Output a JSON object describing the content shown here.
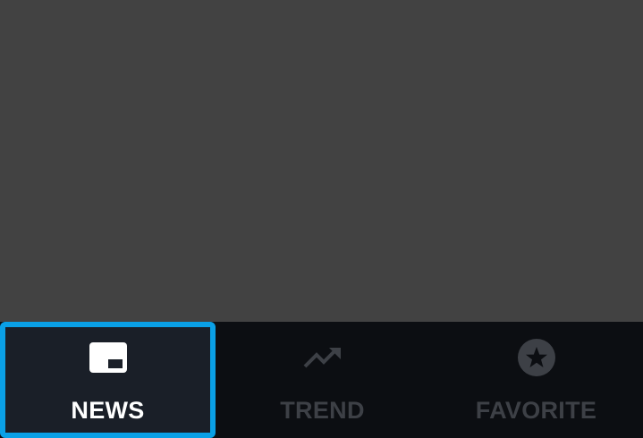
{
  "bottom_nav": {
    "tabs": [
      {
        "label": "NEWS",
        "icon": "news-icon",
        "selected": true
      },
      {
        "label": "TREND",
        "icon": "trending-up-icon",
        "selected": false
      },
      {
        "label": "FAVORITE",
        "icon": "star-circle-icon",
        "selected": false
      }
    ]
  },
  "colors": {
    "content_bg": "#424242",
    "nav_bg": "#0c0e12",
    "selected_bg": "#1a1f28",
    "focus_border": "#0aa0e6",
    "selected_text": "#ffffff",
    "unselected": "#3d4046"
  }
}
